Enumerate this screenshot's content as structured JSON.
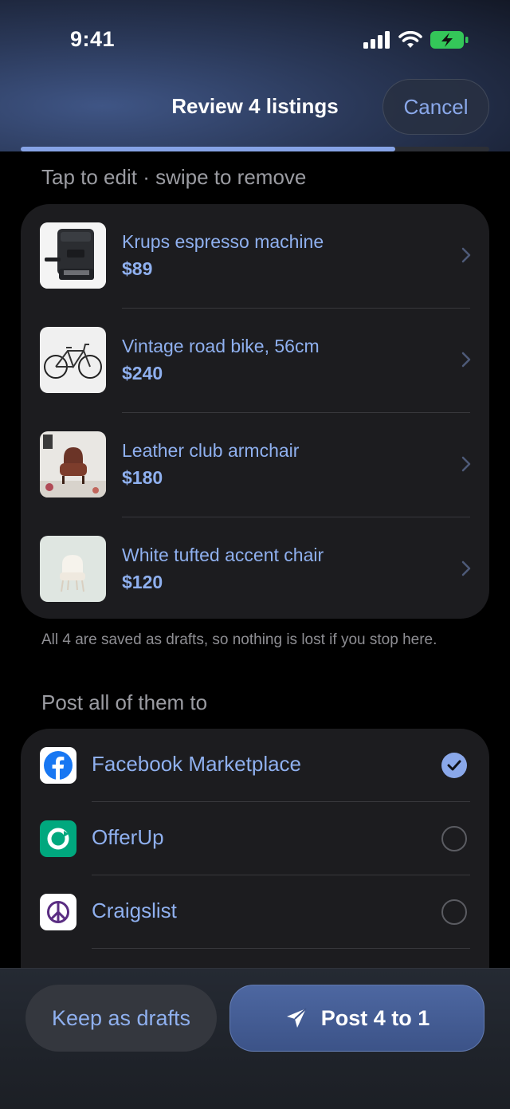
{
  "status_bar": {
    "time": "9:41"
  },
  "header": {
    "title": "Review 4 listings",
    "cancel_label": "Cancel",
    "progress_fraction": 0.8
  },
  "hint": "Tap to edit · swipe to remove",
  "listings": [
    {
      "name": "Krups espresso machine",
      "price": "$89",
      "thumb": "espresso-machine-photo"
    },
    {
      "name": "Vintage road bike, 56cm",
      "price": "$240",
      "thumb": "road-bike-photo"
    },
    {
      "name": "Leather club armchair",
      "price": "$180",
      "thumb": "leather-armchair-photo"
    },
    {
      "name": "White tufted accent chair",
      "price": "$120",
      "thumb": "white-chair-photo"
    }
  ],
  "drafts_note": "All 4 are saved as drafts, so nothing is lost if you stop here.",
  "post_section_title": "Post all of them to",
  "platforms": [
    {
      "name": "Facebook Marketplace",
      "icon": "facebook-icon",
      "selected": true,
      "color": "#1877F2"
    },
    {
      "name": "OfferUp",
      "icon": "offerup-icon",
      "selected": false,
      "color": "#00A87E"
    },
    {
      "name": "Craigslist",
      "icon": "peace-sign-icon",
      "selected": false,
      "color": "#5a2d82"
    }
  ],
  "actions": {
    "keep_drafts_label": "Keep as drafts",
    "post_label": "Post 4 to 1"
  },
  "colors": {
    "accent": "#8aa8ea",
    "card_bg": "#1c1c1f",
    "battery": "#34c759"
  }
}
